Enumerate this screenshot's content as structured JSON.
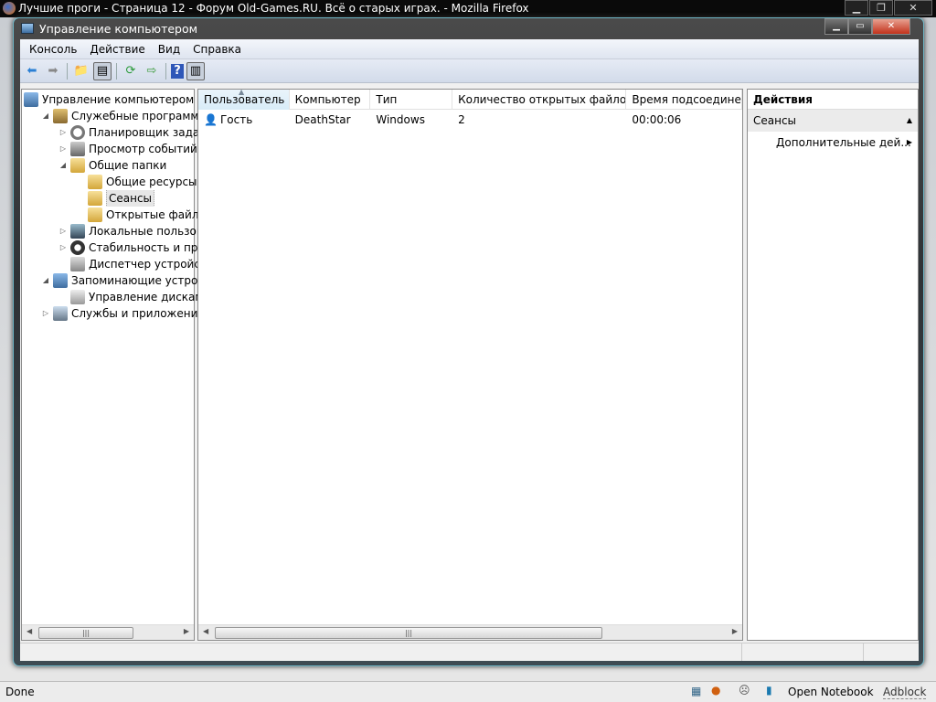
{
  "browser": {
    "title": "Лучшие проги - Страница 12 - Форум Old-Games.RU. Всё о старых играх. - Mozilla Firefox",
    "status": "Done",
    "statusbar_items": {
      "notebook": "Open Notebook",
      "adblock": "Adblock"
    }
  },
  "window": {
    "title": "Управление компьютером"
  },
  "menu": [
    "Консоль",
    "Действие",
    "Вид",
    "Справка"
  ],
  "tree": [
    {
      "label": "Управление компьютером (л",
      "level": 0,
      "icon": "computer-icon"
    },
    {
      "label": "Служебные программы",
      "level": 1,
      "icon": "tools-icon",
      "expanded": true
    },
    {
      "label": "Планировщик заданий",
      "level": 2,
      "icon": "clock-icon"
    },
    {
      "label": "Просмотр событий",
      "level": 2,
      "icon": "event-viewer-icon"
    },
    {
      "label": "Общие папки",
      "level": 2,
      "icon": "shared-folder-icon",
      "expanded": true
    },
    {
      "label": "Общие ресурсы",
      "level": 3,
      "icon": "shared-folder-icon"
    },
    {
      "label": "Сеансы",
      "level": 3,
      "icon": "shared-folder-icon",
      "selected": true
    },
    {
      "label": "Открытые файлы",
      "level": 3,
      "icon": "shared-folder-icon"
    },
    {
      "label": "Локальные пользовате",
      "level": 2,
      "icon": "users-icon"
    },
    {
      "label": "Стабильность и произ",
      "level": 2,
      "icon": "performance-icon"
    },
    {
      "label": "Диспетчер устройств",
      "level": 2,
      "icon": "device-manager-icon"
    },
    {
      "label": "Запоминающие устройст",
      "level": 1,
      "icon": "storage-icon",
      "expanded": true
    },
    {
      "label": "Управление дисками",
      "level": 2,
      "icon": "disk-icon"
    },
    {
      "label": "Службы и приложения",
      "level": 1,
      "icon": "services-icon"
    }
  ],
  "list": {
    "columns": [
      "Пользователь",
      "Компьютер",
      "Тип",
      "Количество открытых файлов",
      "Время подсоединени."
    ],
    "rows": [
      [
        "Гость",
        "DeathStar",
        "Windows",
        "2",
        "00:00:06"
      ]
    ]
  },
  "actions": {
    "header": "Действия",
    "section": "Сеансы",
    "item": "Дополнительные дей..."
  }
}
